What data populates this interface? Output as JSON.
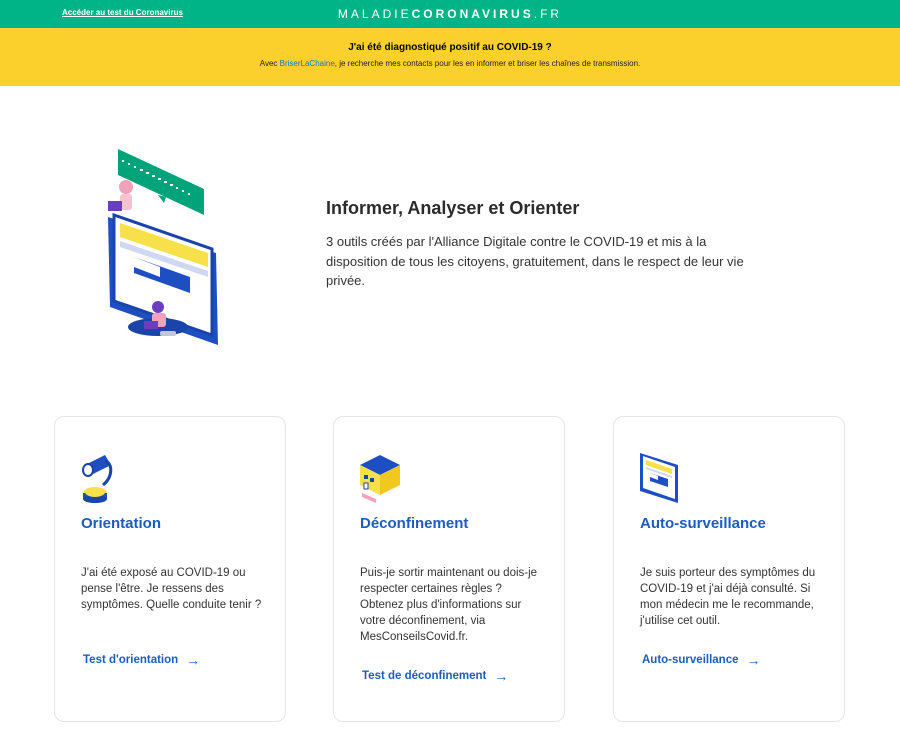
{
  "topbar": {
    "test_link": "Accéder au test du Coronavirus",
    "brand_light": "MALADIE",
    "brand_bold": "CORONAVIRUS",
    "brand_suffix": ".FR"
  },
  "banner": {
    "title": "J'ai été diagnostiqué positif au COVID-19 ?",
    "text_before": "Avec ",
    "link": "BriserLaChaine",
    "text_after": ", je recherche mes contacts pour les en informer et briser les chaînes de transmission."
  },
  "hero": {
    "title": "Informer, Analyser et Orienter",
    "text": "3 outils créés par l'Alliance Digitale contre le COVID-19 et mis à la disposition de tous les citoyens, gratuitement, dans le respect de leur vie privée.",
    "illustration_icon": "monitor-people-illustration"
  },
  "cards": [
    {
      "title": "Orientation",
      "text": "J'ai été exposé au COVID-19 ou pense l'être. Je ressens des symptômes. Quelle conduite tenir ?",
      "link": "Test d'orientation",
      "icon": "lamp-icon"
    },
    {
      "title": "Déconfinement",
      "text": "Puis-je sortir maintenant ou dois-je respecter certaines règles ? Obtenez plus d'informations sur votre déconfinement, via MesConseilsCovid.fr.",
      "link": "Test de déconfinement",
      "icon": "house-icon"
    },
    {
      "title": "Auto-surveillance",
      "text": "Je suis porteur des symptômes du COVID-19 et j'ai déjà consulté. Si mon médecin me le recommande, j'utilise cet outil.",
      "link": "Auto-surveillance",
      "icon": "monitor-icon"
    }
  ],
  "arrow_glyph": "→",
  "colors": {
    "topbar": "#00b487",
    "banner": "#fcd02c",
    "accent_blue": "#1a5dbf"
  }
}
